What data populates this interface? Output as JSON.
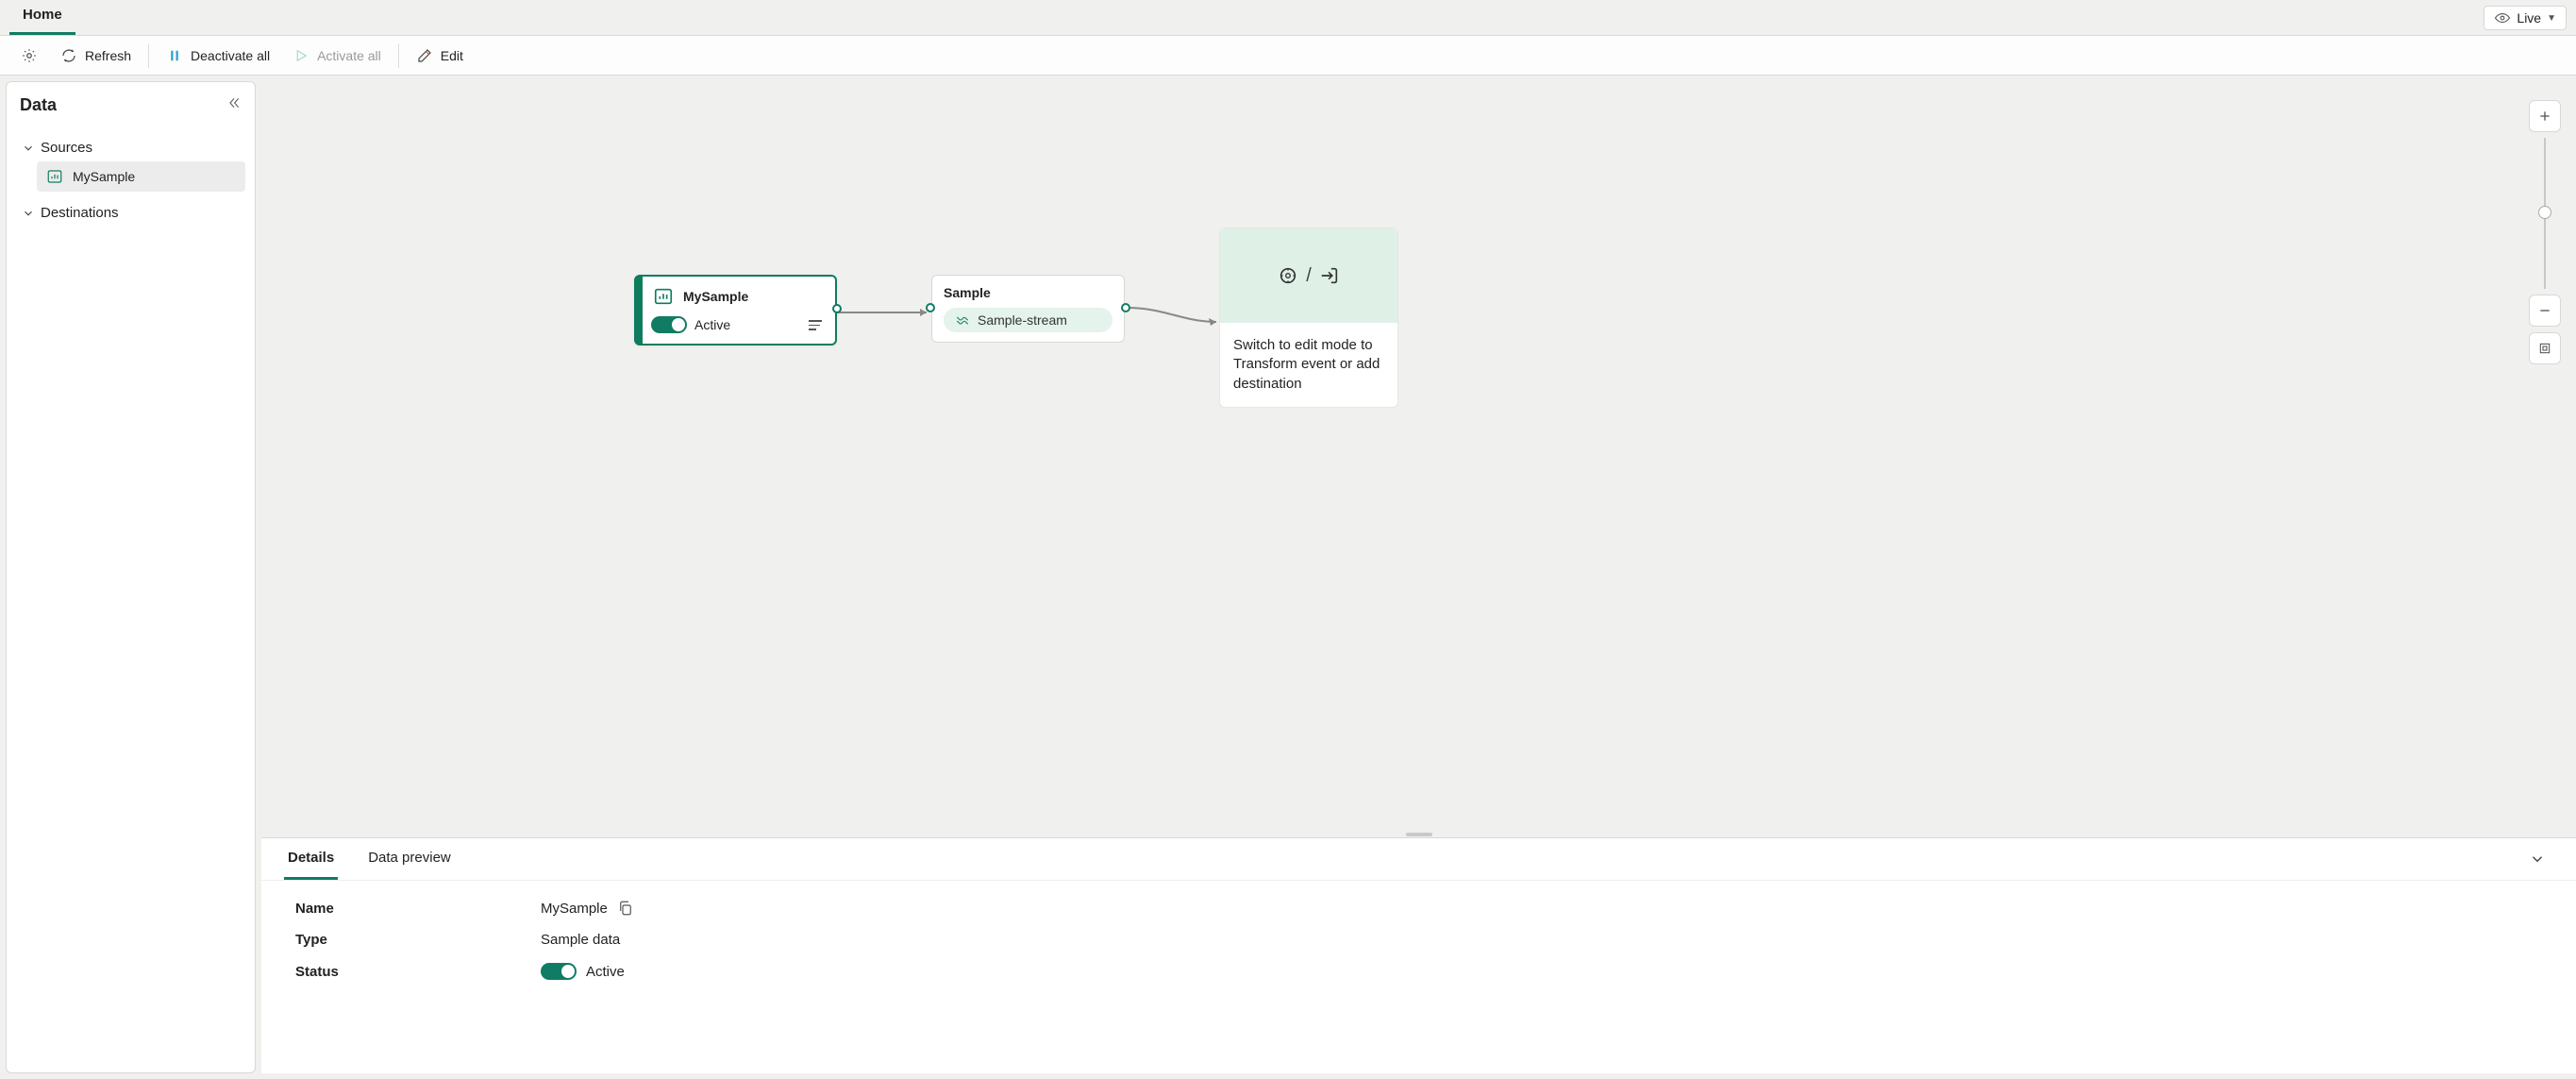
{
  "ribbon": {
    "home": "Home",
    "live": "Live"
  },
  "toolbar": {
    "refresh": "Refresh",
    "deactivate": "Deactivate all",
    "activate": "Activate all",
    "edit": "Edit"
  },
  "sidebar": {
    "title": "Data",
    "sources": "Sources",
    "source_item": "MySample",
    "destinations": "Destinations"
  },
  "canvas": {
    "sourceName": "MySample",
    "sourceStatus": "Active",
    "sampleTitle": "Sample",
    "streamName": "Sample-stream",
    "destHint": "Switch to edit mode to Transform event or add destination"
  },
  "bottom": {
    "tabDetails": "Details",
    "tabPreview": "Data preview",
    "nameLbl": "Name",
    "nameVal": "MySample",
    "typeLbl": "Type",
    "typeVal": "Sample data",
    "statusLbl": "Status",
    "statusVal": "Active"
  }
}
